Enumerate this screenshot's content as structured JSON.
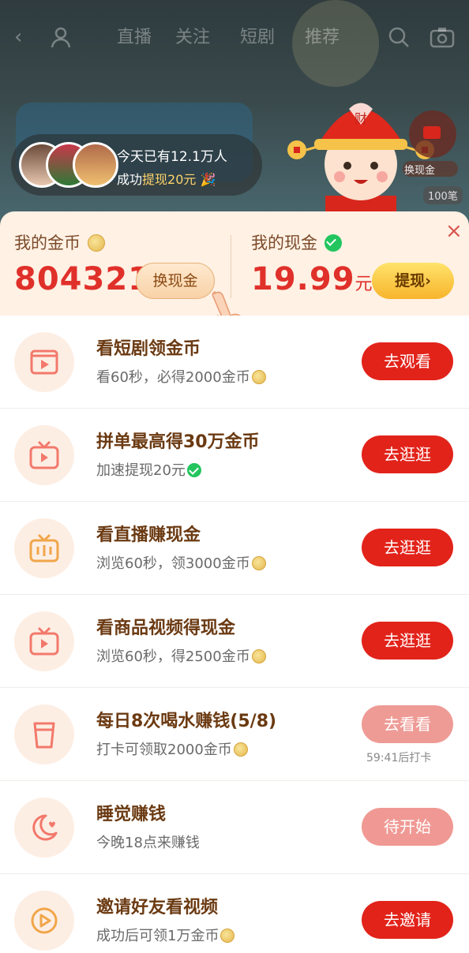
{
  "nav": {
    "tabs": [
      "直播",
      "关注",
      "短剧",
      "推荐"
    ]
  },
  "notice": {
    "line1": "今天已有12.1万人",
    "line2_prefix": "成功",
    "line2_highlight": "提现20元"
  },
  "side_badge": {
    "label": "换现金",
    "count": "100笔"
  },
  "wallet": {
    "coins_title": "我的金币",
    "coins_amount": "804321",
    "exchange_label": "换现金",
    "cash_title": "我的现金",
    "cash_amount": "19.99",
    "cash_unit": "元",
    "withdraw_label": "提现›"
  },
  "tasks": [
    {
      "title": "看短剧领金币",
      "subtitle": "看60秒，必得2000金币",
      "button": "去观看",
      "icon": "play-screen-icon"
    },
    {
      "title": "拼单最高得30万金币",
      "subtitle": "加速提现20元",
      "button": "去逛逛",
      "icon": "tv-icon"
    },
    {
      "title": "看直播赚现金",
      "subtitle": "浏览60秒，领3000金币",
      "button": "去逛逛",
      "icon": "live-tv-icon"
    },
    {
      "title": "看商品视频得现金",
      "subtitle": "浏览60秒，得2500金币",
      "button": "去逛逛",
      "icon": "tv-icon"
    },
    {
      "title": "每日8次喝水赚钱(5/8)",
      "subtitle": "打卡可领取2000金币",
      "button": "去看看",
      "note": "59:41后打卡",
      "icon": "cup-icon"
    },
    {
      "title": "睡觉赚钱",
      "subtitle": "今晚18点来赚钱",
      "button": "待开始",
      "icon": "moon-icon"
    },
    {
      "title": "邀请好友看视频",
      "subtitle": "成功后可领1万金币",
      "button": "去邀请",
      "icon": "play-circle-icon"
    }
  ],
  "colors": {
    "accent_red": "#e2231a",
    "wallet_bg": "#fff1e4",
    "title_brown": "#6b3a12",
    "amount_red": "#e0302a"
  }
}
